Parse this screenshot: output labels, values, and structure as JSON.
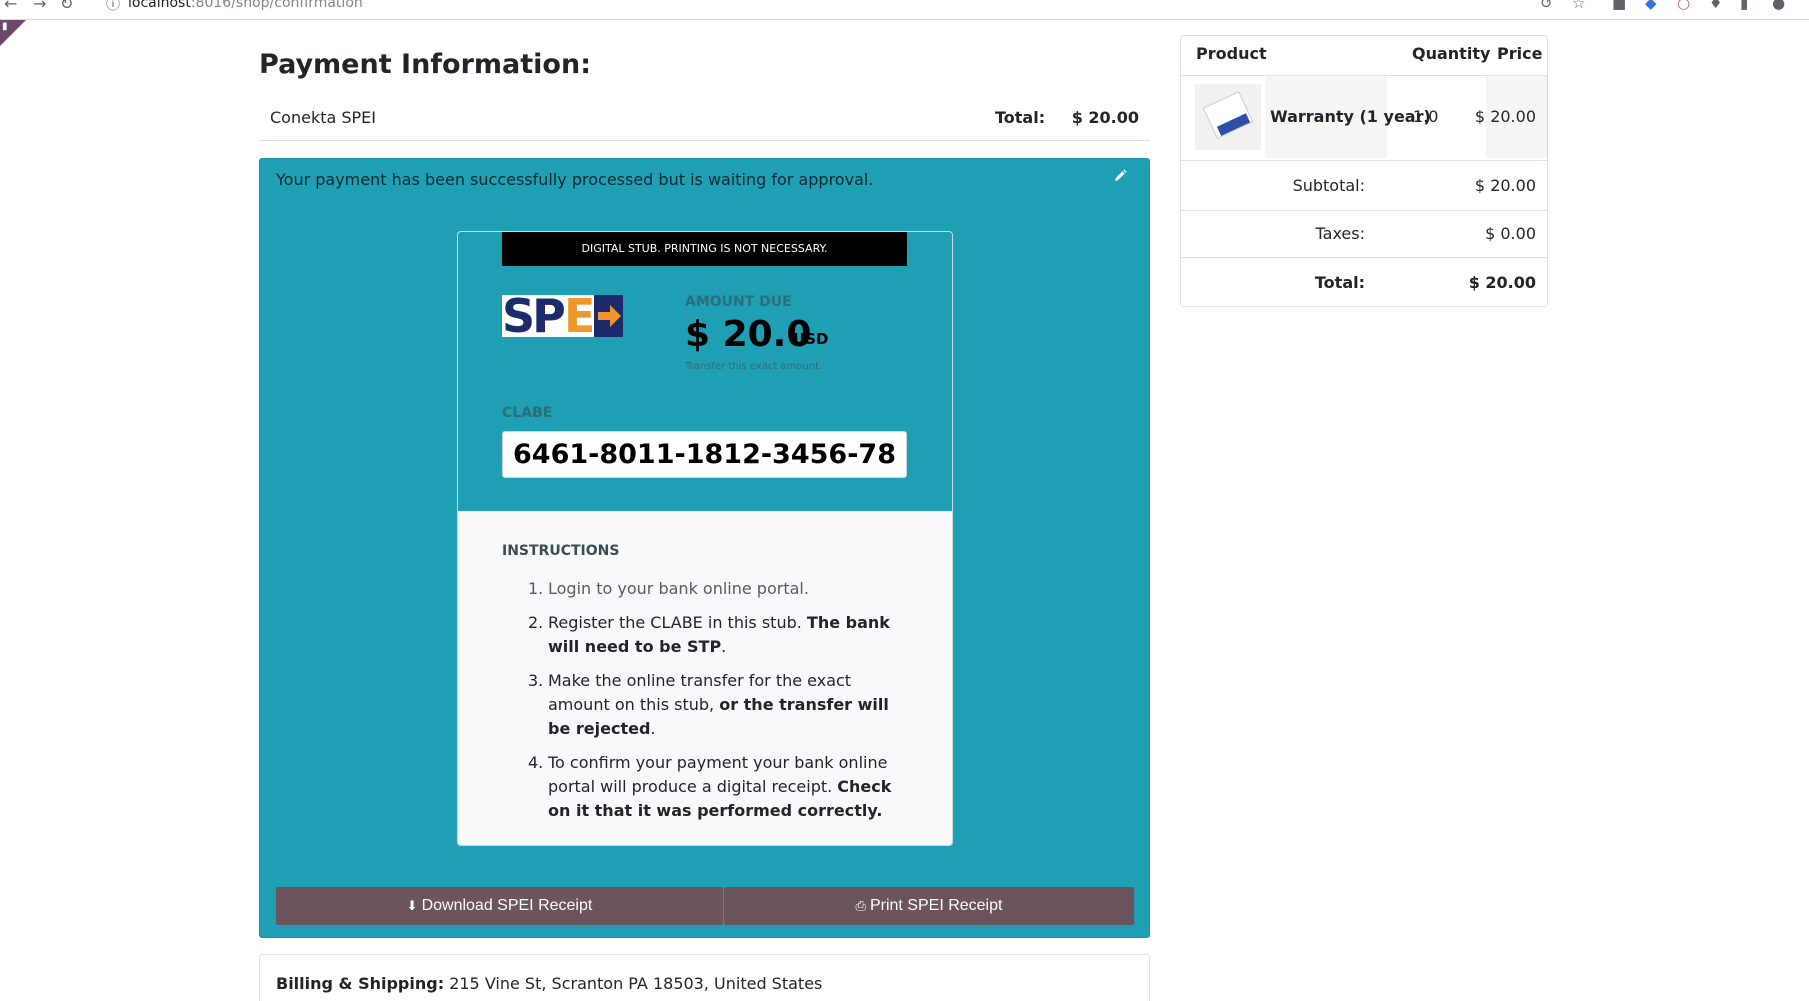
{
  "browser": {
    "url_host": "localhost",
    "url_port": ":8016",
    "url_path": "/shop/confirmation"
  },
  "page": {
    "title": "Payment Information:"
  },
  "payment_method": {
    "name": "Conekta SPEI",
    "total_label": "Total:",
    "total_value": "$ 20.00"
  },
  "status": {
    "message": "Your payment has been successfully processed but is waiting for approval."
  },
  "stub": {
    "banner": "DIGITAL STUB. PRINTING IS NOT NECESSARY.",
    "logo_text": "SPEI",
    "amount_label": "AMOUNT DUE",
    "amount_value": "$ 20.0",
    "amount_currency": "USD",
    "amount_note": "Transfer this exact amount.",
    "clabe_label": "CLABE",
    "clabe_value": "6461-8011-1812-3456-78",
    "instructions_title": "INSTRUCTIONS",
    "instructions": [
      {
        "num": "1.",
        "text": "Login to your bank online portal."
      },
      {
        "num": "2.",
        "text": "Register the CLABE in this stub. ",
        "bold": "The bank will need to be STP",
        "tail": "."
      },
      {
        "num": "3.",
        "text": "Make the online transfer for the exact amount on this stub, ",
        "bold": "or the transfer will be rejected",
        "tail": "."
      },
      {
        "num": "4.",
        "text": "To confirm your payment your bank online portal will produce a digital receipt. ",
        "bold": "Check on it that it was performed correctly.",
        "tail": ""
      }
    ]
  },
  "buttons": {
    "download": "Download SPEI Receipt",
    "print": "Print SPEI Receipt"
  },
  "billing": {
    "label": "Billing & Shipping:",
    "address": " 215 Vine St, Scranton PA 18503, United States"
  },
  "summary": {
    "headers": {
      "product": "Product",
      "quantity": "Quantity",
      "price": "Price"
    },
    "item": {
      "name": "Warranty (1 year)",
      "quantity": "1.0",
      "price": "$ 20.00"
    },
    "subtotal_label": "Subtotal:",
    "subtotal_value": "$ 20.00",
    "taxes_label": "Taxes:",
    "taxes_value": "$ 0.00",
    "total_label": "Total:",
    "total_value": "$ 20.00"
  },
  "colors": {
    "teal": "#1f9fb4",
    "button": "#6b545e",
    "spei_navy": "#1d2a6b",
    "spei_orange": "#f0962a"
  }
}
